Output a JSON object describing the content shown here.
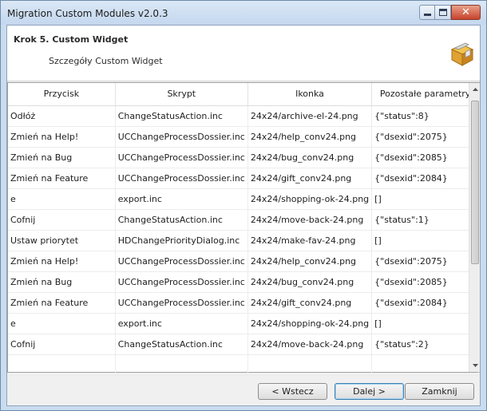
{
  "window": {
    "title": "Migration Custom Modules v2.0.3"
  },
  "header": {
    "step_title": "Krok 5. Custom Widget",
    "step_subtitle": "Szczegóły Custom Widget"
  },
  "table": {
    "columns": [
      "Przycisk",
      "Skrypt",
      "Ikonka",
      "Pozostałe parametry"
    ],
    "rows": [
      [
        "Odłóż",
        "ChangeStatusAction.inc",
        "24x24/archive-el-24.png",
        "{\"status\":8}"
      ],
      [
        "Zmień na Help!",
        "UCChangeProcessDossier.inc",
        "24x24/help_conv24.png",
        "{\"dsexid\":2075}"
      ],
      [
        "Zmień na Bug",
        "UCChangeProcessDossier.inc",
        "24x24/bug_conv24.png",
        "{\"dsexid\":2085}"
      ],
      [
        "Zmień na Feature",
        "UCChangeProcessDossier.inc",
        "24x24/gift_conv24.png",
        "{\"dsexid\":2084}"
      ],
      [
        "e",
        "export.inc",
        "24x24/shopping-ok-24.png",
        "[]"
      ],
      [
        "Cofnij",
        "ChangeStatusAction.inc",
        "24x24/move-back-24.png",
        "{\"status\":1}"
      ],
      [
        "Ustaw priorytet",
        "HDChangePriorityDialog.inc",
        "24x24/make-fav-24.png",
        "[]"
      ],
      [
        "Zmień na Help!",
        "UCChangeProcessDossier.inc",
        "24x24/help_conv24.png",
        "{\"dsexid\":2075}"
      ],
      [
        "Zmień na Bug",
        "UCChangeProcessDossier.inc",
        "24x24/bug_conv24.png",
        "{\"dsexid\":2085}"
      ],
      [
        "Zmień na Feature",
        "UCChangeProcessDossier.inc",
        "24x24/gift_conv24.png",
        "{\"dsexid\":2084}"
      ],
      [
        "e",
        "export.inc",
        "24x24/shopping-ok-24.png",
        "[]"
      ],
      [
        "Cofnij",
        "ChangeStatusAction.inc",
        "24x24/move-back-24.png",
        "{\"status\":2}"
      ],
      [
        "",
        "",
        "",
        ""
      ]
    ]
  },
  "buttons": {
    "back": "< Wstecz",
    "next": "Dalej >",
    "close": "Zamknij"
  },
  "icons": {
    "window_controls": [
      "minimize-icon",
      "maximize-icon",
      "close-icon"
    ],
    "header_icon": "package-box-icon"
  },
  "colors": {
    "titlebar": "#c9dcef",
    "close_button": "#c7432b",
    "default_button_border": "#3c7fb1"
  }
}
